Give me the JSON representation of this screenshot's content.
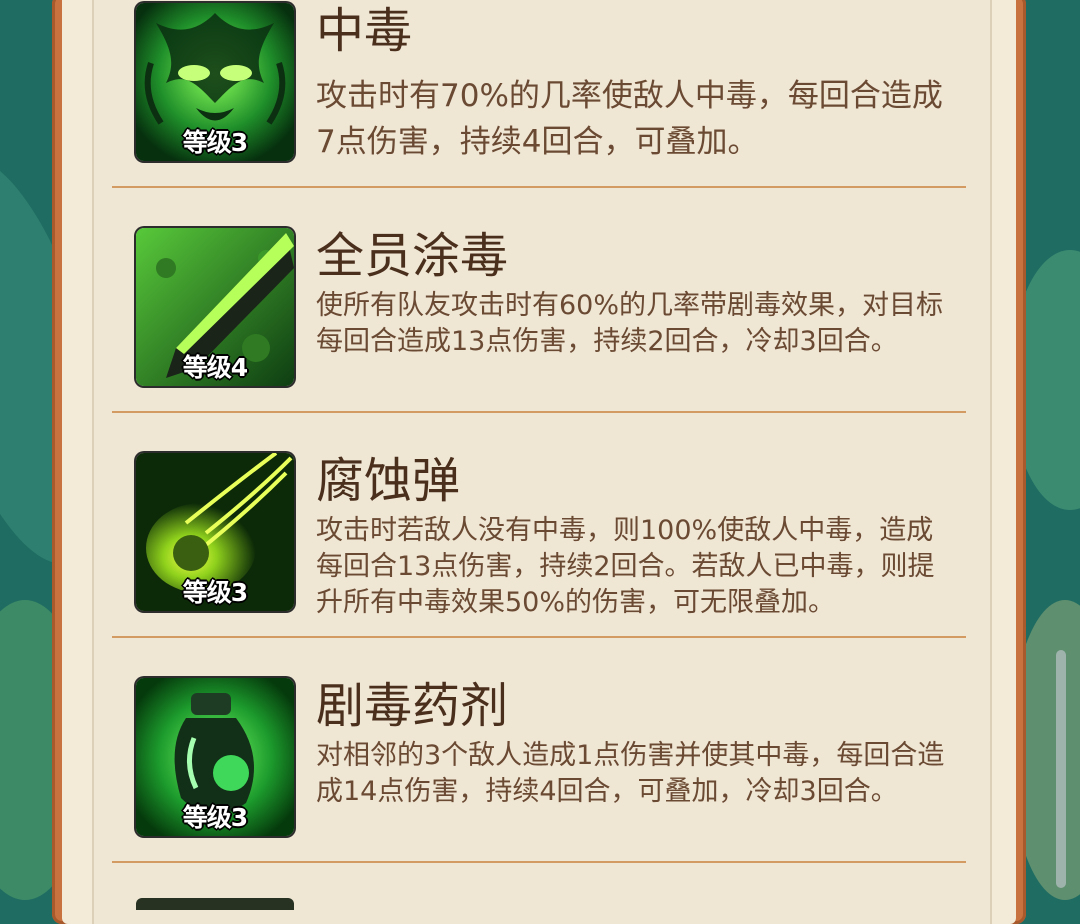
{
  "skills": [
    {
      "name": "中毒",
      "level_label": "等级3",
      "description": "攻击时有70%的几率使敌人中毒，每回合造成7点伤害，持续4回合，可叠加。",
      "icon": "poison-mask-icon"
    },
    {
      "name": "全员涂毒",
      "level_label": "等级4",
      "description": "使所有队友攻击时有60%的几率带剧毒效果，对目标每回合造成13点伤害，持续2回合，冷却3回合。",
      "icon": "poison-blade-icon"
    },
    {
      "name": "腐蚀弹",
      "level_label": "等级3",
      "description": "攻击时若敌人没有中毒，则100%使敌人中毒，造成每回合13点伤害，持续2回合。若敌人已中毒，则提升所有中毒效果50%的伤害，可无限叠加。",
      "icon": "corrosion-bullet-icon"
    },
    {
      "name": "剧毒药剂",
      "level_label": "等级3",
      "description": "对相邻的3个敌人造成1点伤害并使其中毒，每回合造成14点伤害，持续4回合，可叠加，冷却3回合。",
      "icon": "poison-potion-icon"
    }
  ],
  "colors": {
    "frame": "#c8733f",
    "panel": "#efe6d4",
    "divider": "#d39a62",
    "title": "#4b2f1d",
    "text": "#6b4a33"
  }
}
